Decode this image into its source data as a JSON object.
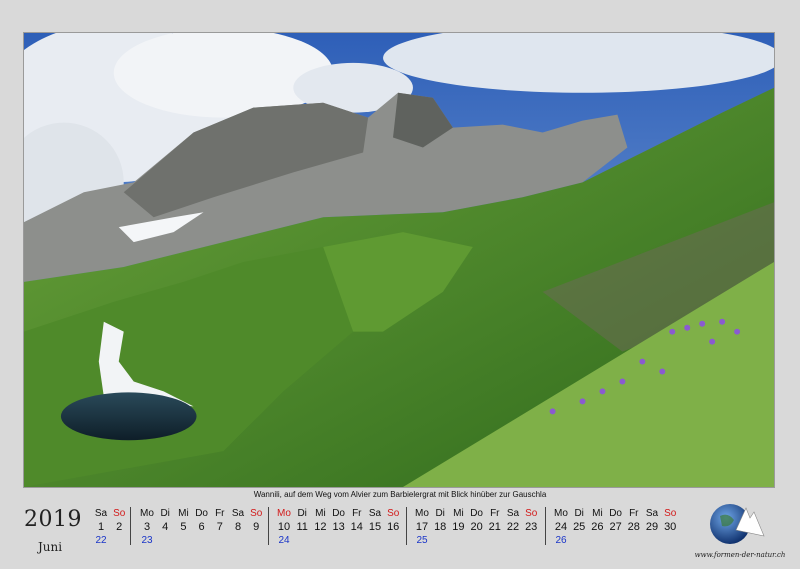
{
  "caption": "Wannili, auf dem Weg vom Alvier zum Barbielergrat mit Blick hinüber zur Gauschla",
  "year": "2019",
  "month": "Juni",
  "weeks": [
    {
      "days": [
        {
          "n": "Sa",
          "d": "1"
        },
        {
          "n": "So",
          "d": "2"
        }
      ],
      "kw": "22"
    },
    {
      "days": [
        {
          "n": "Mo",
          "d": "3"
        },
        {
          "n": "Di",
          "d": "4"
        },
        {
          "n": "Mi",
          "d": "5"
        },
        {
          "n": "Do",
          "d": "6"
        },
        {
          "n": "Fr",
          "d": "7"
        },
        {
          "n": "Sa",
          "d": "8"
        },
        {
          "n": "So",
          "d": "9"
        }
      ],
      "kw": "23"
    },
    {
      "days": [
        {
          "n": "Mo",
          "d": "10",
          "holiday": true
        },
        {
          "n": "Di",
          "d": "11"
        },
        {
          "n": "Mi",
          "d": "12"
        },
        {
          "n": "Do",
          "d": "13"
        },
        {
          "n": "Fr",
          "d": "14"
        },
        {
          "n": "Sa",
          "d": "15"
        },
        {
          "n": "So",
          "d": "16"
        }
      ],
      "kw": "24"
    },
    {
      "days": [
        {
          "n": "Mo",
          "d": "17"
        },
        {
          "n": "Di",
          "d": "18"
        },
        {
          "n": "Mi",
          "d": "19"
        },
        {
          "n": "Do",
          "d": "20"
        },
        {
          "n": "Fr",
          "d": "21"
        },
        {
          "n": "Sa",
          "d": "22"
        },
        {
          "n": "So",
          "d": "23"
        }
      ],
      "kw": "25"
    },
    {
      "days": [
        {
          "n": "Mo",
          "d": "24"
        },
        {
          "n": "Di",
          "d": "25"
        },
        {
          "n": "Mi",
          "d": "26"
        },
        {
          "n": "Do",
          "d": "27"
        },
        {
          "n": "Fr",
          "d": "28"
        },
        {
          "n": "Sa",
          "d": "29"
        },
        {
          "n": "So",
          "d": "30"
        }
      ],
      "kw": "26"
    }
  ],
  "logo_text": "www.formen-der-natur.ch",
  "colors": {
    "sunday": "#d21a1a",
    "week_number": "#1a35c8",
    "background": "#d9d9d9"
  }
}
